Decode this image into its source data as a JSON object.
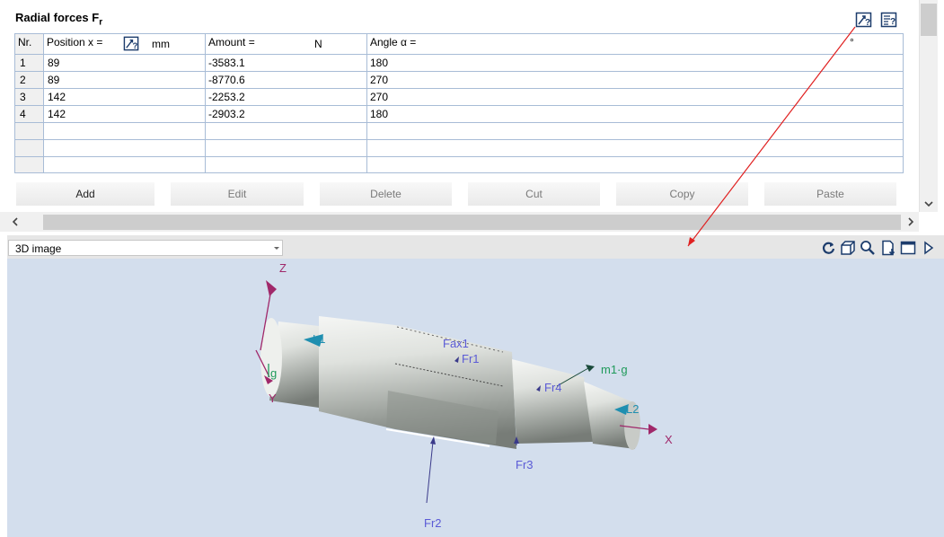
{
  "section": {
    "title": "Radial forces F",
    "title_sub": "r"
  },
  "table": {
    "headers": {
      "nr": "Nr.",
      "position": "Position x =",
      "position_unit": "mm",
      "amount": "Amount =",
      "amount_unit": "N",
      "angle": "Angle α =",
      "angle_unit": "°"
    },
    "rows": [
      {
        "nr": "1",
        "position": "89",
        "amount": "-3583.1",
        "angle": "180"
      },
      {
        "nr": "2",
        "position": "89",
        "amount": "-8770.6",
        "angle": "270"
      },
      {
        "nr": "3",
        "position": "142",
        "amount": "-2253.2",
        "angle": "270"
      },
      {
        "nr": "4",
        "position": "142",
        "amount": "-2903.2",
        "angle": "180"
      }
    ]
  },
  "buttons": {
    "add": "Add",
    "edit": "Edit",
    "delete": "Delete",
    "cut": "Cut",
    "copy": "Copy",
    "paste": "Paste"
  },
  "view": {
    "selected": "3D image"
  },
  "scene": {
    "axis_z": "Z",
    "axis_y": "Y",
    "axis_x": "X",
    "gravity": "g",
    "L1": "L1",
    "L2": "L2",
    "Fax1": "Fax1",
    "Fr1": "Fr1",
    "Fr2": "Fr2",
    "Fr3": "Fr3",
    "Fr4": "Fr4",
    "m1g": "m1·g"
  },
  "colors": {
    "grid": "#a8bcd6",
    "view_bg": "#d3deed",
    "force_label": "#5a5ad6",
    "axis": "#a0286a",
    "weight": "#1f9a5a",
    "bearing": "#1f8fb0",
    "arrow_annotation": "#e02020"
  }
}
